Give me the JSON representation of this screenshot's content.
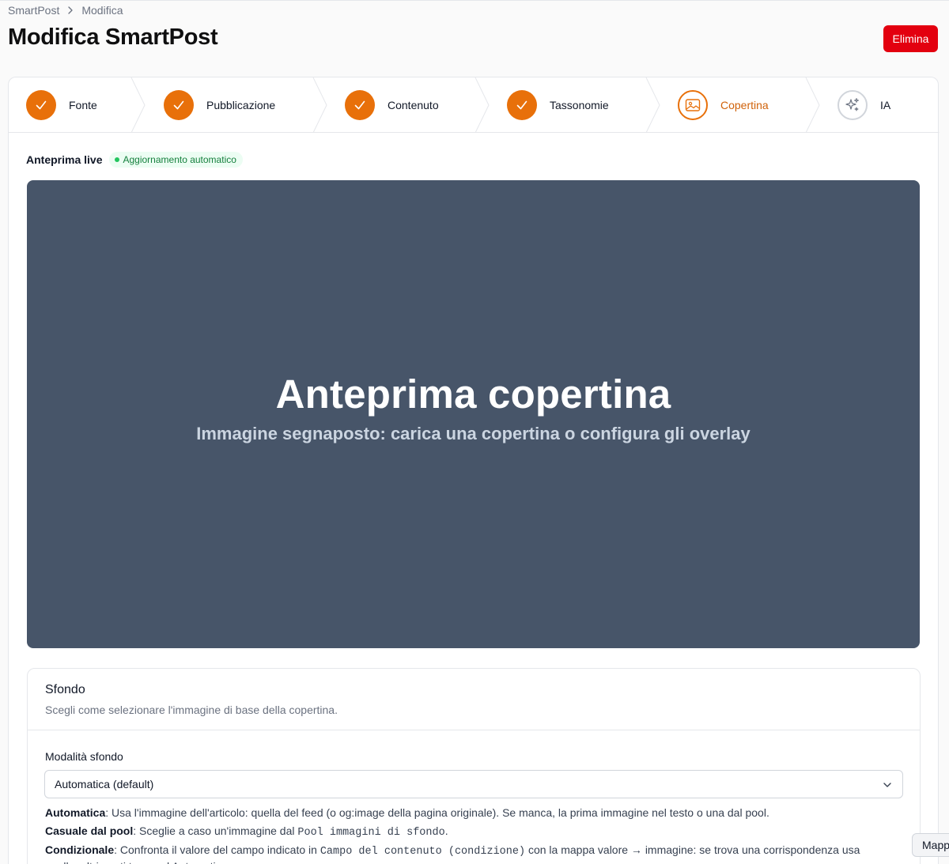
{
  "breadcrumb": {
    "root": "SmartPost",
    "current": "Modifica"
  },
  "page": {
    "title": "Modifica SmartPost",
    "delete_label": "Elimina"
  },
  "steps": [
    {
      "label": "Fonte",
      "state": "done",
      "icon": "check-icon"
    },
    {
      "label": "Pubblicazione",
      "state": "done",
      "icon": "check-icon"
    },
    {
      "label": "Contenuto",
      "state": "done",
      "icon": "check-icon"
    },
    {
      "label": "Tassonomie",
      "state": "done",
      "icon": "check-icon"
    },
    {
      "label": "Copertina",
      "state": "current",
      "icon": "image-icon"
    },
    {
      "label": "IA",
      "state": "pending",
      "icon": "sparkles-icon"
    }
  ],
  "live": {
    "title": "Anteprima live",
    "badge": "Aggiornamento automatico"
  },
  "preview": {
    "title": "Anteprima copertina",
    "subtitle": "Immagine segnaposto: carica una copertina o configura gli overlay"
  },
  "background_card": {
    "title": "Sfondo",
    "description": "Scegli come selezionare l'immagine di base della copertina.",
    "field_label": "Modalità sfondo",
    "select_value": "Automatica (default)",
    "help": [
      {
        "term": "Automatica",
        "text": ": Usa l'immagine dell'articolo: quella del feed (o og:image della pagina originale). Se manca, la prima immagine nel testo o una dal pool."
      },
      {
        "term": "Casuale dal pool",
        "text_before": ": Sceglie a caso un'immagine dal ",
        "code": "Pool immagini di sfondo",
        "text_after": "."
      },
      {
        "term": "Condizionale",
        "text_before": ": Confronta il valore del campo indicato in ",
        "code": "Campo del contenuto (condizione)",
        "text_after": " con la mappa valore → immagine: se trova una corrispondenza usa quella, altrimenti torna ad Automatica."
      }
    ]
  },
  "tooltip": {
    "text": "Mapp"
  },
  "colors": {
    "accent": "#e8700a",
    "danger": "#e3000f",
    "preview_bg": "#475569",
    "success": "#15803d"
  }
}
